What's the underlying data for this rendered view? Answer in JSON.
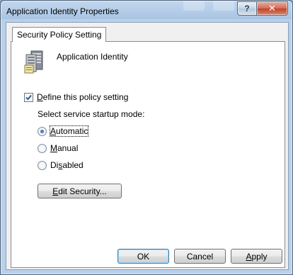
{
  "window": {
    "title": "Application Identity Properties"
  },
  "title_buttons": {
    "help": "?",
    "close": "✕"
  },
  "tabs": [
    {
      "label": "Security Policy Setting"
    }
  ],
  "policy": {
    "name": "Application Identity",
    "icon": "server-icon"
  },
  "define": {
    "label_accel": "D",
    "label_rest": "efine this policy setting",
    "checked": true
  },
  "startup": {
    "label": "Select service startup mode:",
    "options": [
      {
        "accel": "A",
        "rest": "utomatic",
        "selected": true
      },
      {
        "accel": "M",
        "rest": "anual",
        "selected": false
      },
      {
        "pre": "Di",
        "accel": "s",
        "rest": "abled",
        "selected": false
      }
    ]
  },
  "edit_security": {
    "accel": "E",
    "rest": "dit Security..."
  },
  "footer": {
    "ok": "OK",
    "cancel": "Cancel",
    "apply_accel": "A",
    "apply_rest": "pply"
  }
}
